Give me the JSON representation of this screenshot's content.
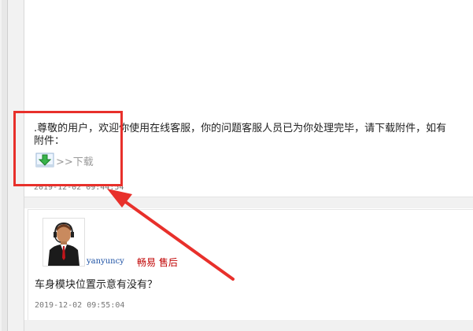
{
  "message1": {
    "line1": ".尊敬的用户，欢迎你使用在线客服，你的问题客服人员已为你处理完毕，请下载附件，如有",
    "line2": "附件：",
    "download_label": ">>下载",
    "timestamp": "2019-12-02 09:44:54"
  },
  "message2": {
    "username": "yanyuncy",
    "role": "畅易 售后",
    "text": "车身模块位置示意有没有？",
    "timestamp": "2019-12-02 09:55:04"
  },
  "icons": {
    "download": "download-arrow-icon",
    "avatar": "support-agent-avatar"
  },
  "colors": {
    "annotation": "#e8302b",
    "username": "#1a4fa3",
    "role": "#c00000",
    "download_arrow": "#37b34a"
  }
}
